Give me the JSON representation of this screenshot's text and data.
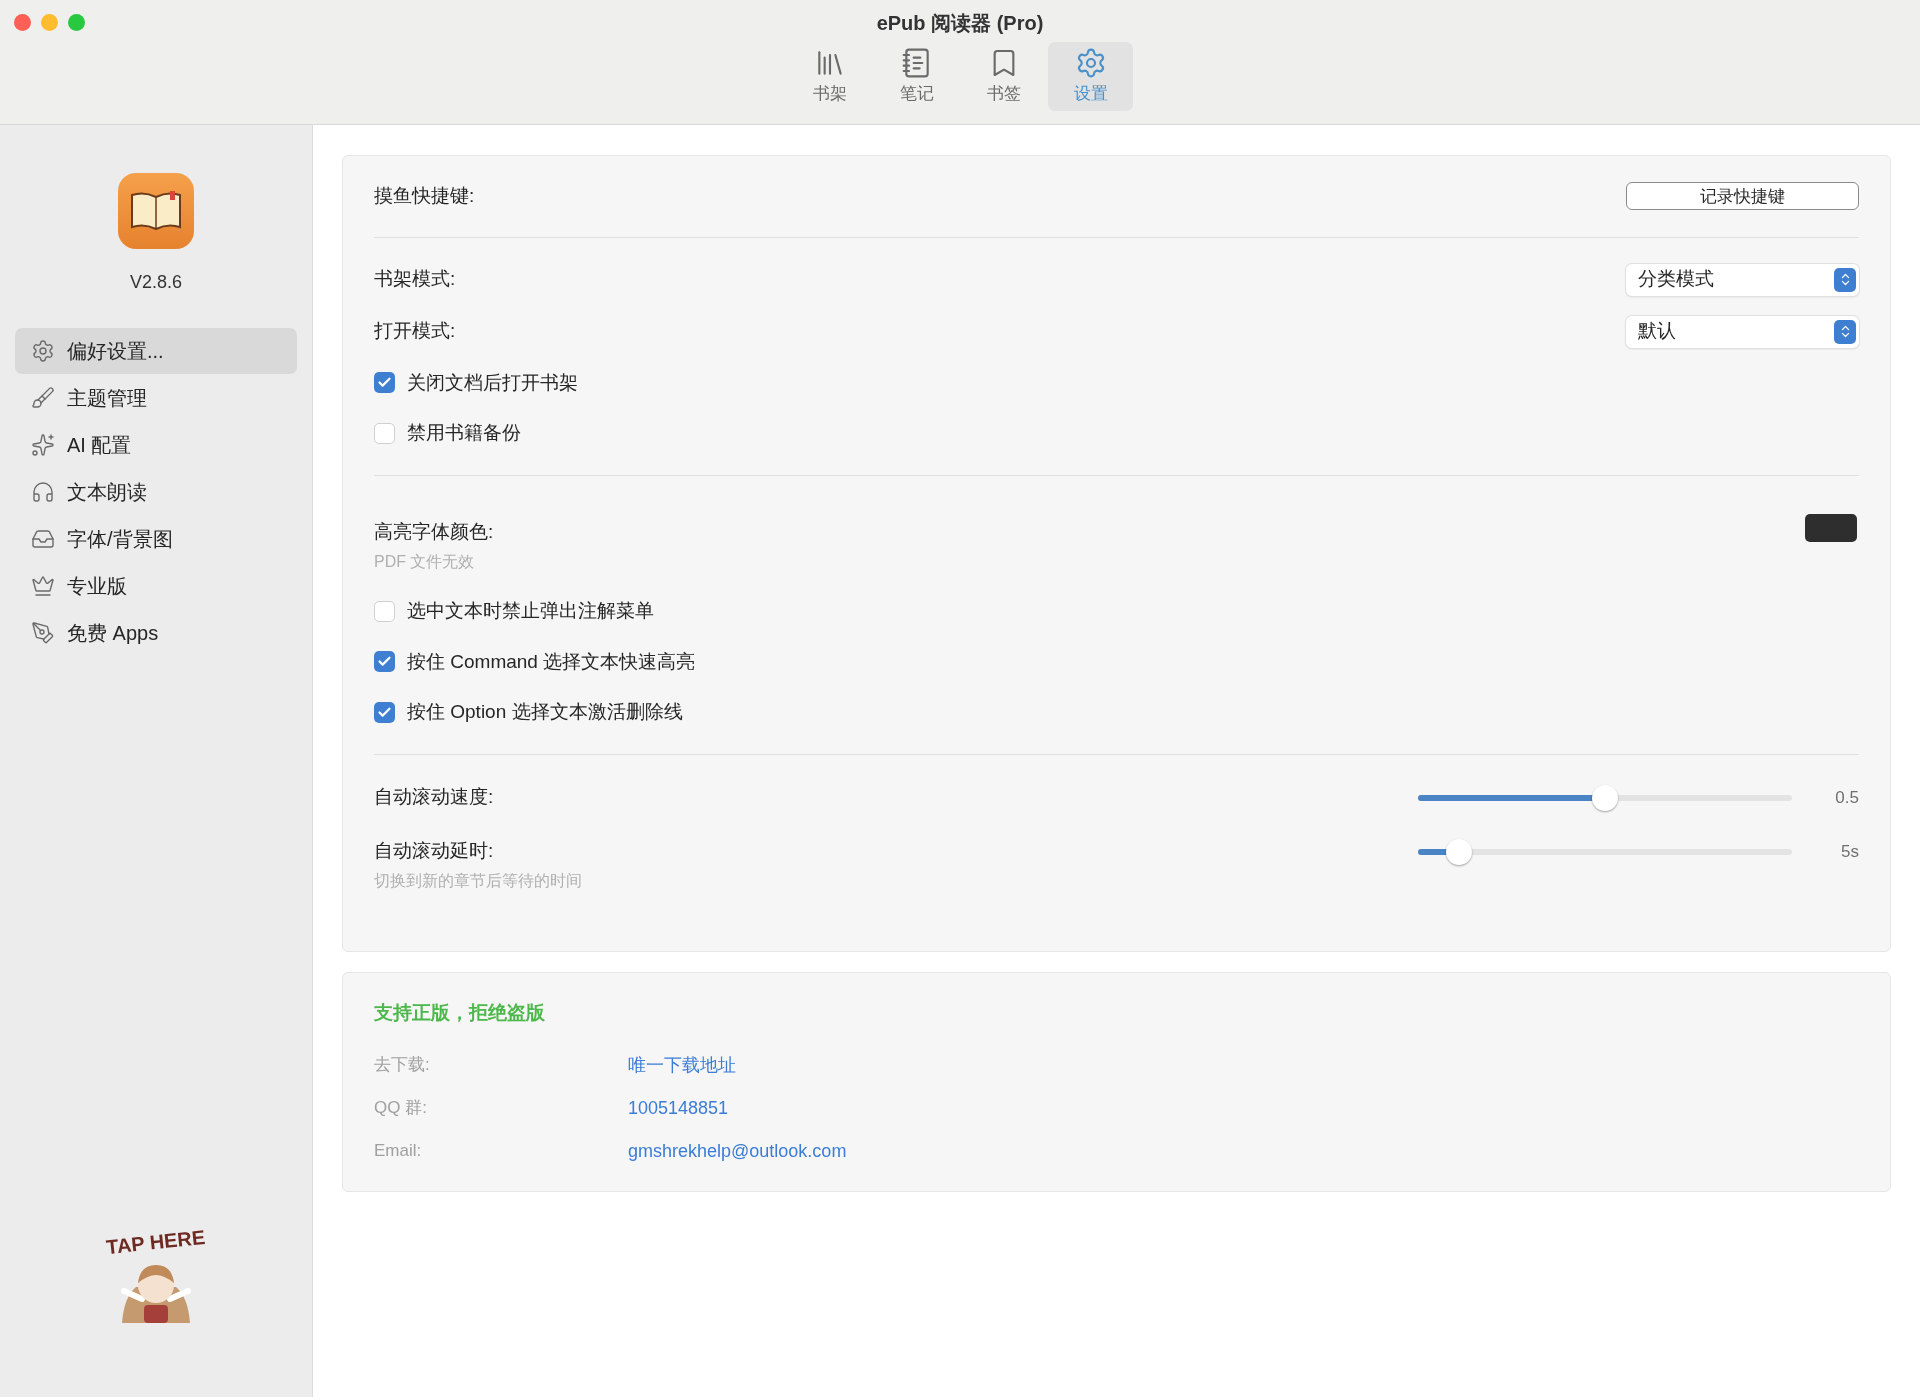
{
  "window": {
    "title": "ePub 阅读器 (Pro)"
  },
  "toolbar_tabs": [
    {
      "label": "书架",
      "selected": false
    },
    {
      "label": "笔记",
      "selected": false
    },
    {
      "label": "书签",
      "selected": false
    },
    {
      "label": "设置",
      "selected": true
    }
  ],
  "sidebar": {
    "version": "V2.8.6",
    "items": [
      {
        "label": "偏好设置...",
        "selected": true
      },
      {
        "label": "主题管理",
        "selected": false
      },
      {
        "label": "AI 配置",
        "selected": false
      },
      {
        "label": "文本朗读",
        "selected": false
      },
      {
        "label": "字体/背景图",
        "selected": false
      },
      {
        "label": "专业版",
        "selected": false
      },
      {
        "label": "免费 Apps",
        "selected": false
      }
    ],
    "mascot": {
      "caption": "TAP HERE"
    }
  },
  "settings": [
    {
      "rows": [
        {
          "kind": "button",
          "label": "摸鱼快捷键:",
          "button": "记录快捷键"
        }
      ]
    },
    {
      "rows": [
        {
          "kind": "select",
          "label": "书架模式:",
          "value": "分类模式"
        },
        {
          "kind": "select",
          "label": "打开模式:",
          "value": "默认"
        },
        {
          "kind": "checkbox",
          "label": "关闭文档后打开书架",
          "checked": true
        },
        {
          "kind": "checkbox",
          "label": "禁用书籍备份",
          "checked": false
        }
      ]
    },
    {
      "rows": [
        {
          "kind": "color",
          "label": "高亮字体颜色:",
          "hint": "PDF 文件无效",
          "color": "#2e2e2e"
        },
        {
          "kind": "checkbox",
          "label": "选中文本时禁止弹出注解菜单",
          "checked": false
        },
        {
          "kind": "checkbox",
          "label": "按住 Command 选择文本快速高亮",
          "checked": true
        },
        {
          "kind": "checkbox",
          "label": "按住 Option 选择文本激活删除线",
          "checked": true
        }
      ]
    },
    {
      "rows": [
        {
          "kind": "slider",
          "label": "自动滚动速度:",
          "level": 0.5,
          "reading": "0.5"
        },
        {
          "kind": "slider",
          "label": "自动滚动延时:",
          "hint": "切换到新的章节后等待的时间",
          "level": 0.11,
          "reading": "5s"
        }
      ]
    }
  ],
  "support": {
    "title": "支持正版，拒绝盗版",
    "rows": [
      {
        "label": "去下载:",
        "value": "唯一下载地址"
      },
      {
        "label": "QQ 群:",
        "value": "1005148851"
      },
      {
        "label": "Email:",
        "value": "gmshrekhelp@outlook.com"
      }
    ]
  }
}
